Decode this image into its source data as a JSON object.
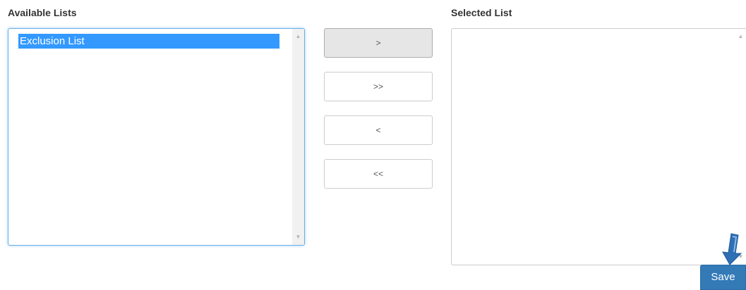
{
  "available_lists": {
    "label": "Available Lists",
    "items": [
      {
        "label": "Exclusion List",
        "selected": true
      }
    ]
  },
  "selected_list": {
    "label": "Selected List",
    "items": []
  },
  "move_buttons": {
    "move_right": ">",
    "move_all_right": ">>",
    "move_left": "<",
    "move_all_left": "<<"
  },
  "save_label": "Save",
  "icons": {
    "annotation": "down-arrow-icon",
    "scroll_up": "scroll-up-arrow-icon",
    "scroll_down": "scroll-down-arrow-icon"
  },
  "colors": {
    "primary": "#337ab7",
    "selection": "#3399ff",
    "focus_border": "#66afe9",
    "annotation_arrow": "#2f6fb5"
  }
}
